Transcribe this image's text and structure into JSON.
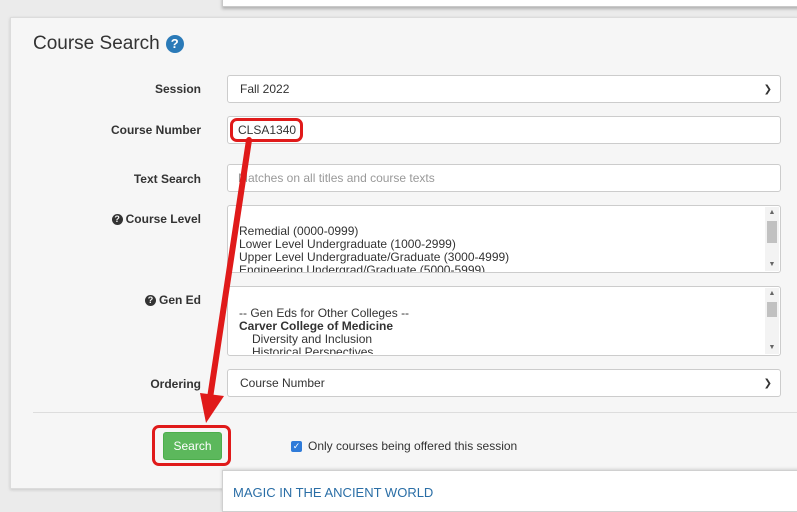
{
  "page_title": "Course Search",
  "fields": {
    "session": {
      "label": "Session",
      "value": "Fall 2022"
    },
    "course_number": {
      "label": "Course Number",
      "value": "CLSA1340"
    },
    "text_search": {
      "label": "Text Search",
      "placeholder": "Matches on all titles and course texts"
    },
    "course_level": {
      "label": "Course Level",
      "options": [
        "Remedial (0000-0999)",
        "Lower Level Undergraduate (1000-2999)",
        "Upper Level Undergraduate/Graduate (3000-4999)",
        "Engineering Undergrad/Graduate (5000-5999)"
      ]
    },
    "gen_ed": {
      "label": "Gen Ed",
      "options": [
        "-- Gen Eds for Other Colleges --",
        "Carver College of Medicine",
        "Diversity and Inclusion",
        "Historical Perspectives"
      ]
    },
    "ordering": {
      "label": "Ordering",
      "value": "Course Number"
    }
  },
  "search_button": "Search",
  "only_offered_checkbox": {
    "label": "Only courses being offered this session",
    "checked": true
  },
  "result_preview": "MAGIC IN THE ANCIENT WORLD",
  "colors": {
    "accent": "#2a7ab8",
    "button": "#5cb85c",
    "highlight": "#e01a1a"
  },
  "icons": [
    "help-circle-icon",
    "question-icon",
    "chevron-down-icon",
    "checkmark-icon"
  ]
}
